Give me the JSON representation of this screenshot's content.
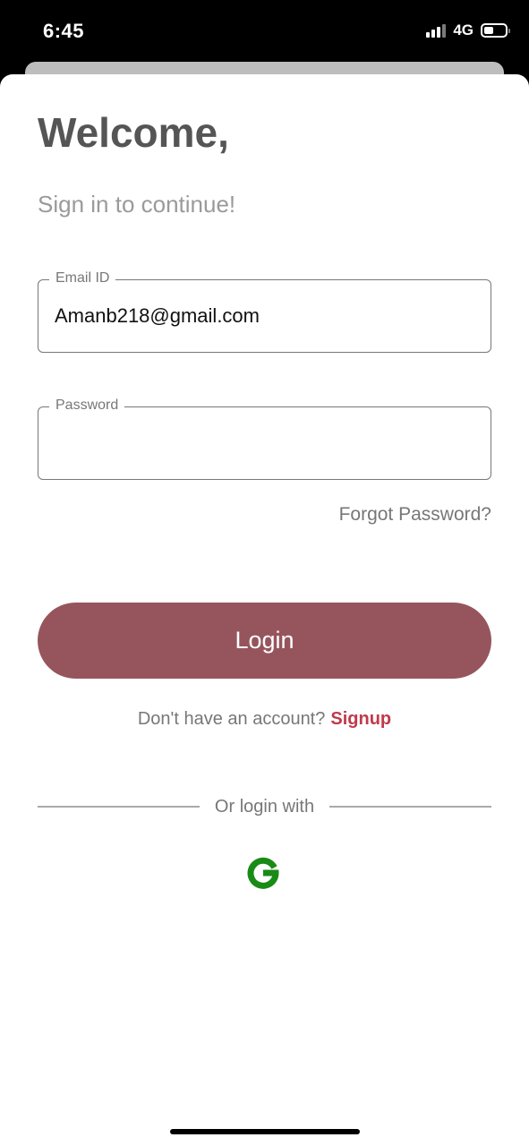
{
  "status_bar": {
    "time": "6:45",
    "network": "4G",
    "signal_icon": "cellular-signal-icon",
    "battery_icon": "battery-icon"
  },
  "header": {
    "title": "Welcome,",
    "subtitle": "Sign in to continue!"
  },
  "form": {
    "email": {
      "label": "Email ID",
      "value": "Amanb218@gmail.com",
      "placeholder": ""
    },
    "password": {
      "label": "Password",
      "value": "",
      "placeholder": ""
    },
    "forgot_password": "Forgot Password?",
    "login_label": "Login"
  },
  "signup": {
    "prompt": "Don't have an account?",
    "link": "Signup"
  },
  "social": {
    "divider_text": "Or login with",
    "google_icon": "google-g-icon"
  },
  "colors": {
    "primary_button": "#96555c",
    "signup_link": "#c03a4b",
    "google_green": "#1a8a17",
    "title": "#555555"
  }
}
